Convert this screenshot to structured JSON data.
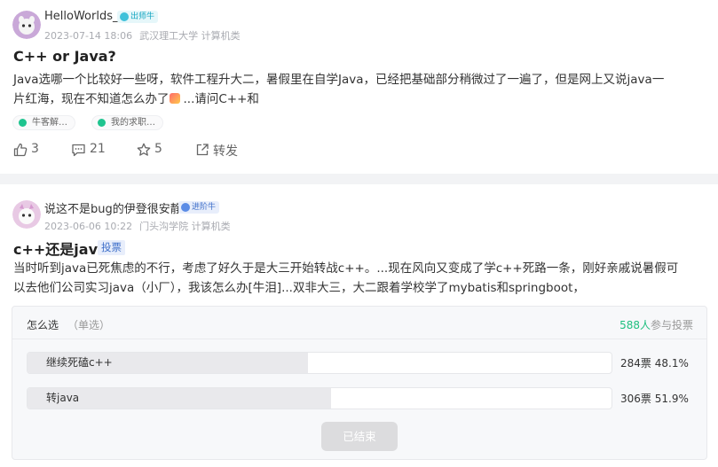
{
  "posts": [
    {
      "username": "HelloWorlds_",
      "badge": "出师牛",
      "date": "2023-07-14 18:06",
      "school": "武汉理工大学 计算机类",
      "title": "C++ or Java?",
      "body_line1": "Java选哪一个比较好一些呀，软件工程升大二，暑假里在自学Java，已经把基础部分稍微过了一遍了，但是网上又说java一",
      "body_line2": "片红海，现在不知道怎么办了",
      "body_line2_tail": "...请问C++和",
      "tags": [
        "牛客解…",
        "我的求职…"
      ],
      "actions": {
        "likes": "3",
        "comments": "21",
        "favorites": "5",
        "share": "转发"
      }
    },
    {
      "username": "说这不是bug的伊登很安静",
      "badge": "进阶牛",
      "date": "2023-06-06 10:22",
      "school": "门头沟学院 计算机类",
      "title": "c++还是java",
      "vote_label": "投票",
      "body_line1": "当时听到java已死焦虑的不行，考虑了好久于是大三开始转战c++。...现在风向又变成了学c++死路一条，刚好亲戚说暑假可",
      "body_line2": "以去他们公司实习java（小厂），我该怎么办[牛泪]...双非大三，大二跟着学校学了mybatis和springboot，",
      "poll": {
        "question": "怎么选",
        "hint": "（单选）",
        "participants": "588人",
        "participants_suffix": "参与投票",
        "options": [
          {
            "label": "继续死磕c++",
            "votes": "284票",
            "percent": "48.1%",
            "fraction": 0.481
          },
          {
            "label": "转java",
            "votes": "306票",
            "percent": "51.9%",
            "fraction": 0.519
          }
        ],
        "ended_label": "已结束"
      }
    }
  ],
  "colors": {
    "accent_green": "#1fbf7f",
    "badge_blue": "#3d6ec9",
    "badge_cyan": "#12a5c0",
    "meta_gray": "#a9abb1"
  },
  "icons": [
    "avatar-cartoon",
    "badge-icon",
    "tag-icon",
    "thumbs-up-icon",
    "comment-icon",
    "star-icon",
    "share-icon"
  ]
}
